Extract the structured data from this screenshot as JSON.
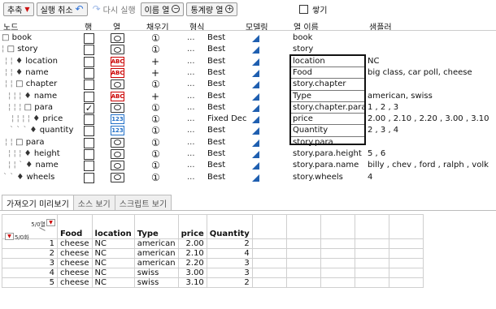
{
  "toolbar": {
    "add_label": "추축",
    "undo_label": "실행 취소",
    "redo_label": "다시 실행",
    "name_col_label": "이름 열",
    "stats_col_label": "통계량 열",
    "stack_label": "쌓기"
  },
  "headers": {
    "node": "노드",
    "row": "행",
    "col": "열",
    "fill": "채우기",
    "format": "형식",
    "modeling": "모델링",
    "column_name": "열 이름",
    "sample": "샘플러"
  },
  "rows": [
    {
      "node": "book",
      "guide": "",
      "marker": "□",
      "row_checked": false,
      "col_type": "empty",
      "fill": "①",
      "fmt_dots": "...",
      "fmt": "Best",
      "column_name": "book",
      "sample": ""
    },
    {
      "node": "story",
      "guide": "¦ ",
      "marker": "□",
      "row_checked": false,
      "col_type": "empty",
      "fill": "①",
      "fmt_dots": "...",
      "fmt": "Best",
      "column_name": "story",
      "sample": ""
    },
    {
      "node": "location",
      "guide": "¦ ¦ ",
      "marker": "♦",
      "row_checked": false,
      "col_type": "abc",
      "fill": "+",
      "fmt_dots": "...",
      "fmt": "Best",
      "column_name": "location",
      "sample": "NC"
    },
    {
      "node": "name",
      "guide": "¦ ¦ ",
      "marker": "♦",
      "row_checked": false,
      "col_type": "abc",
      "fill": "+",
      "fmt_dots": "...",
      "fmt": "Best",
      "column_name": "Food",
      "sample": "big class, car poll, cheese"
    },
    {
      "node": "chapter",
      "guide": "¦ ¦ ",
      "marker": "□",
      "row_checked": false,
      "col_type": "empty",
      "fill": "①",
      "fmt_dots": "...",
      "fmt": "Best",
      "column_name": "story.chapter",
      "sample": ""
    },
    {
      "node": "name",
      "guide": "¦ ¦ ¦ ",
      "marker": "♦",
      "row_checked": false,
      "col_type": "abc",
      "fill": "+",
      "fmt_dots": "...",
      "fmt": "Best",
      "column_name": "Type",
      "sample": "american, swiss"
    },
    {
      "node": "para",
      "guide": "¦ ¦ ¦ ",
      "marker": "□",
      "row_checked": true,
      "col_type": "empty",
      "fill": "①",
      "fmt_dots": "...",
      "fmt": "Best",
      "column_name": "story.chapter.para",
      "sample": "1 , 2 , 3"
    },
    {
      "node": "price",
      "guide": "¦ ¦ ¦ ¦ ",
      "marker": "♦",
      "row_checked": false,
      "col_type": "num",
      "fill": "①",
      "fmt_dots": "...",
      "fmt": "Fixed Dec",
      "column_name": "price",
      "sample": "2.00 , 2.10 , 2.20 , 3.00 , 3.10"
    },
    {
      "node": "quantity",
      "guide": "` ` ` ",
      "marker": "♦",
      "row_checked": false,
      "col_type": "num",
      "fill": "①",
      "fmt_dots": "...",
      "fmt": "Best",
      "column_name": "Quantity",
      "sample": "2 , 3 , 4"
    },
    {
      "node": "para",
      "guide": "¦ ¦ ",
      "marker": "□",
      "row_checked": false,
      "col_type": "empty",
      "fill": "①",
      "fmt_dots": "...",
      "fmt": "Best",
      "column_name": "story.para",
      "sample": ""
    },
    {
      "node": "height",
      "guide": "¦ ¦ ¦ ",
      "marker": "♦",
      "row_checked": false,
      "col_type": "empty",
      "fill": "①",
      "fmt_dots": "...",
      "fmt": "Best",
      "column_name": "story.para.height",
      "sample": "5 , 6"
    },
    {
      "node": "name",
      "guide": "¦ ¦ ` ",
      "marker": "♦",
      "row_checked": false,
      "col_type": "empty",
      "fill": "①",
      "fmt_dots": "...",
      "fmt": "Best",
      "column_name": "story.para.name",
      "sample": "billy , chev , ford , ralph , volk"
    },
    {
      "node": "wheels",
      "guide": "` ` ",
      "marker": "♦",
      "row_checked": false,
      "col_type": "empty",
      "fill": "①",
      "fmt_dots": "...",
      "fmt": "Best",
      "column_name": "story.wheels",
      "sample": "4"
    }
  ],
  "col_icon_text": {
    "abc": "ABC",
    "num": "123",
    "empty": ""
  },
  "tabs": [
    {
      "label": "가져오기 미리보기",
      "active": true
    },
    {
      "label": "소스 보기",
      "active": false
    },
    {
      "label": "스크립트 보기",
      "active": false
    }
  ],
  "preview": {
    "corner_cols": "5/0열",
    "corner_rows": "5/0화",
    "columns": [
      "Food",
      "location",
      "Type",
      "price",
      "Quantity"
    ],
    "rows": [
      {
        "n": "1",
        "cells": [
          "cheese",
          "NC",
          "american",
          "2.00",
          "2"
        ]
      },
      {
        "n": "2",
        "cells": [
          "cheese",
          "NC",
          "american",
          "2.10",
          "4"
        ]
      },
      {
        "n": "3",
        "cells": [
          "cheese",
          "NC",
          "american",
          "2.20",
          "3"
        ]
      },
      {
        "n": "4",
        "cells": [
          "cheese",
          "NC",
          "swiss",
          "3.00",
          "3"
        ]
      },
      {
        "n": "5",
        "cells": [
          "cheese",
          "NC",
          "swiss",
          "3.10",
          "2"
        ]
      }
    ]
  },
  "colors": {
    "modeling": "#1f5fb0",
    "abc": "#cc0000",
    "num": "#2270c8"
  }
}
